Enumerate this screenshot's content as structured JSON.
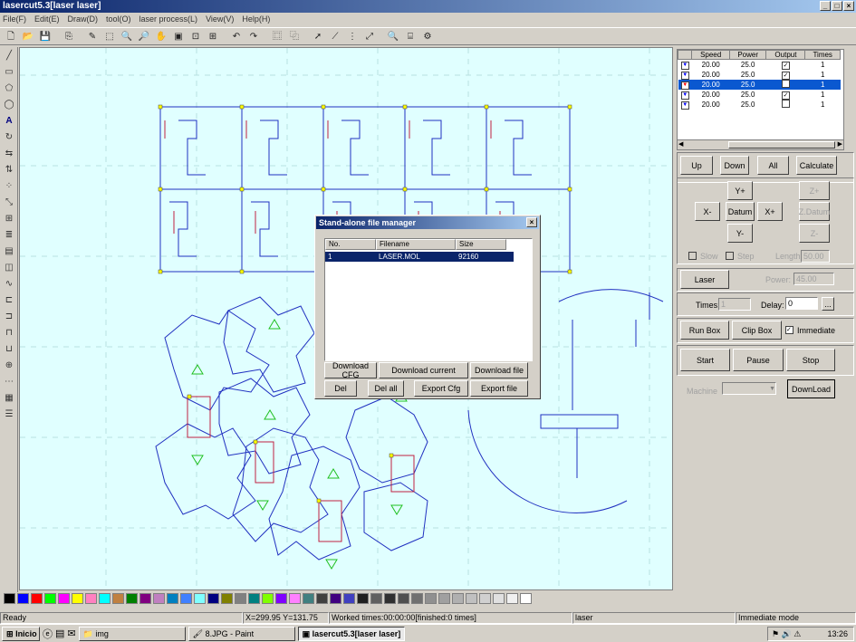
{
  "window": {
    "title": "lasercut5.3[laser laser]"
  },
  "menu": [
    "File(F)",
    "Edit(E)",
    "Draw(D)",
    "tool(O)",
    "laser process(L)",
    "View(V)",
    "Help(H)"
  ],
  "table": {
    "headers": [
      "Speed",
      "Power",
      "Output",
      "Times"
    ],
    "rows": [
      {
        "speed": "20.00",
        "power": "25.0",
        "output": "✓",
        "times": "1",
        "selected": false
      },
      {
        "speed": "20.00",
        "power": "25.0",
        "output": "✓",
        "times": "1",
        "selected": false
      },
      {
        "speed": "20.00",
        "power": "25.0",
        "output": "",
        "times": "1",
        "selected": true
      },
      {
        "speed": "20.00",
        "power": "25.0",
        "output": "✓",
        "times": "1",
        "selected": false
      },
      {
        "speed": "20.00",
        "power": "25.0",
        "output": "",
        "times": "1",
        "selected": false
      }
    ]
  },
  "layer_buttons": {
    "up": "Up",
    "down": "Down",
    "all": "All",
    "calculate": "Calculate"
  },
  "jog": {
    "y_plus": "Y+",
    "x_minus": "X-",
    "datum": "Datum",
    "x_plus": "X+",
    "y_minus": "Y-",
    "z_plus": "Z+",
    "z_datum": "Z.Datum",
    "z_minus": "Z-",
    "slow": "Slow",
    "step": "Step",
    "length_label": "Length",
    "length_value": "50.00"
  },
  "laser": {
    "button": "Laser",
    "power_label": "Power:",
    "power_value": "45.00"
  },
  "times": {
    "label": "Times:",
    "value": "1",
    "delay_label": "Delay:",
    "delay_value": "0",
    "browse": "..."
  },
  "box": {
    "run": "Run Box",
    "clip": "Clip Box",
    "immediate": "Immediate"
  },
  "control": {
    "start": "Start",
    "pause": "Pause",
    "stop": "Stop"
  },
  "machine": {
    "label": "Machine",
    "download": "DownLoad"
  },
  "dialog": {
    "title": "Stand-alone file manager",
    "columns": [
      "No.",
      "Filename",
      "Size"
    ],
    "rows": [
      {
        "no": "1",
        "filename": "LASER.MOL",
        "size": "92160"
      }
    ],
    "buttons": {
      "download_cfg": "Download CFG",
      "download_current": "Download current",
      "download_file": "Download file",
      "del": "Del",
      "del_all": "Del all",
      "export_cfg": "Export Cfg",
      "export_file": "Export file"
    }
  },
  "palette": [
    "#000000",
    "#0000ff",
    "#ff0000",
    "#00ff00",
    "#ff00ff",
    "#ffff00",
    "#ff80c0",
    "#00ffff",
    "#c08040",
    "#008000",
    "#800080",
    "#c080c0",
    "#0080c0",
    "#4080ff",
    "#80ffff",
    "#000080",
    "#808000",
    "#808080",
    "#008080",
    "#80ff00",
    "#8000ff",
    "#ff80ff",
    "#408080",
    "#404040",
    "#400080",
    "#4040c0",
    "#202020",
    "#606060",
    "#303030",
    "#505050",
    "#707070",
    "#909090",
    "#a0a0a0",
    "#b0b0b0",
    "#c0c0c0",
    "#d0d0d0",
    "#e0e0e0",
    "#f0f0f0",
    "#ffffff"
  ],
  "status": {
    "ready": "Ready",
    "coords": "X=299.95 Y=131.75",
    "worked": "Worked times:00:00:00[finished:0 times]",
    "device": "laser",
    "mode": "Immediate mode"
  },
  "taskbar": {
    "start": "Inicio",
    "tasks": [
      "img",
      "8.JPG - Paint",
      "lasercut5.3[laser laser]"
    ],
    "clock": "13:26"
  }
}
